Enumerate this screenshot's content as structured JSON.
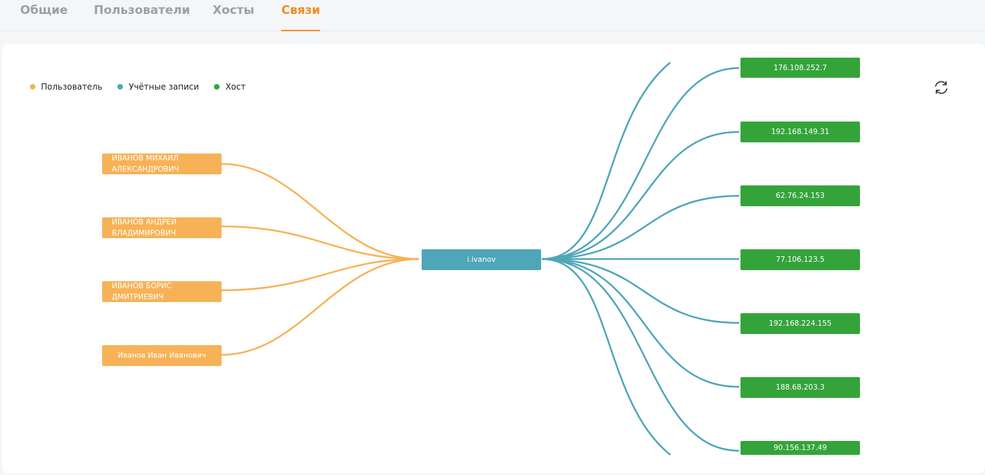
{
  "tabs": [
    {
      "label": "Общие"
    },
    {
      "label": "Пользователи"
    },
    {
      "label": "Хосты"
    },
    {
      "label": "Связи"
    }
  ],
  "legend": {
    "user": "Пользователь",
    "account": "Учётные записи",
    "host": "Хост"
  },
  "colors": {
    "accent": "#f08c1e",
    "user": "#f7b257",
    "account": "#4ea6b8",
    "host": "#34a43a"
  },
  "icons": {
    "refresh": "refresh-icon"
  },
  "graph": {
    "users": [
      {
        "label": "ИВАНОВ МИХАИЛ АЛЕКСАНДРОВИЧ"
      },
      {
        "label": "ИВАНОВ АНДРЕЙ ВЛАДИМИРОВИЧ"
      },
      {
        "label": "ИВАНОВ БОРИС ДМИТРИЕВИЧ"
      },
      {
        "label": "Иванов Иван Иванович"
      }
    ],
    "account": {
      "label": "i.ivanov"
    },
    "hosts": [
      {
        "label": "176.108.252.7"
      },
      {
        "label": "192.168.149.31"
      },
      {
        "label": "62.76.24.153"
      },
      {
        "label": "77.106.123.5"
      },
      {
        "label": "192.168.224.155"
      },
      {
        "label": "188.68.203.3"
      },
      {
        "label": "90.156.137.49"
      }
    ]
  }
}
